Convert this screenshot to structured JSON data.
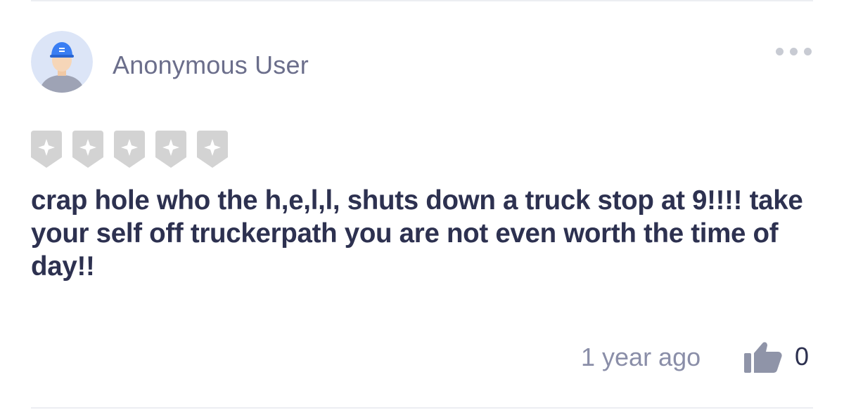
{
  "review": {
    "author": "Anonymous User",
    "rating": 0,
    "rating_max": 5,
    "text": "crap hole who the h,e,l,l, shuts down a truck stop at 9!!!! take your self off truckerpath you are not even worth the time of day!!",
    "timestamp": "1 year ago",
    "like_count": "0"
  },
  "icons": {
    "avatar": "default-trucker-avatar-icon",
    "more": "more-options-icon",
    "star": "empty-star-shield-icon",
    "like": "thumbs-up-icon"
  },
  "colors": {
    "author_text": "#6b6e8b",
    "body_text": "#2d3150",
    "meta_text": "#8a8ea8",
    "star_empty": "#d3d3d3",
    "avatar_bg": "#dce5f7",
    "avatar_cap": "#3a7ef3",
    "thumb": "#8f94a8",
    "divider": "#eceef2"
  }
}
